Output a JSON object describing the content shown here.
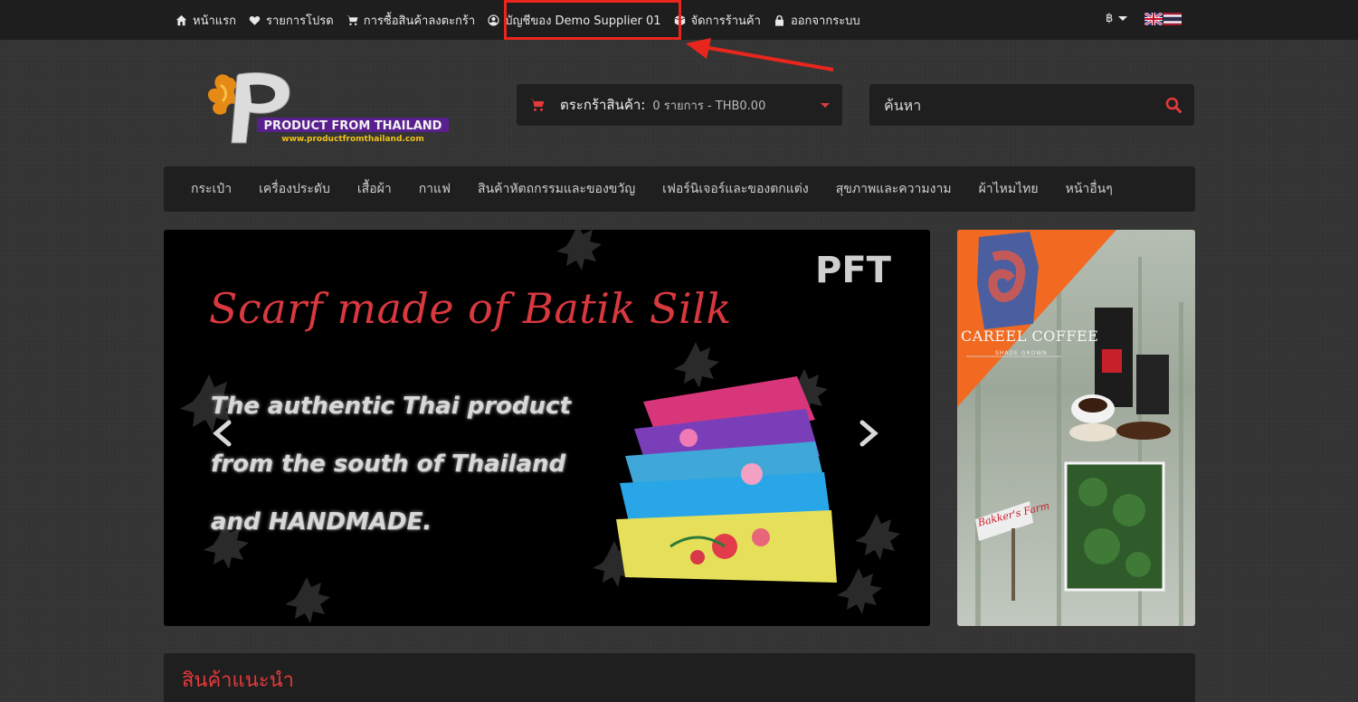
{
  "topbar": {
    "home_label": "หน้าแรก",
    "wishlist_label": "รายการโปรด",
    "cart_label": "การซื้อสินค้าลงตะกร้า",
    "account_label": "บัญชีของ Demo Supplier 01",
    "manage_store_label": "จัดการร้านค้า",
    "logout_label": "ออกจากระบบ",
    "currency_symbol": "฿",
    "languages": [
      "English",
      "Thai"
    ]
  },
  "logo": {
    "brand": "PRODUCT FROM THAILAND",
    "url_text": "www.productfromthailand.com"
  },
  "cart": {
    "title": "ตระกร้าสินค้า:",
    "summary": "0 รายการ - THB0.00"
  },
  "search": {
    "placeholder": "ค้นหา"
  },
  "categories": [
    "กระเป๋า",
    "เครื่องประดับ",
    "เสื้อผ้า",
    "กาแฟ",
    "สินค้าหัตถกรรมและของขวัญ",
    "เฟอร์นิเจอร์และของตกแต่ง",
    "สุขภาพและความงาม",
    "ผ้าไหมไทย",
    "หน้าอื่นๆ"
  ],
  "slider": {
    "title": "Scarf made of Batik Silk",
    "lines": [
      "The authentic Thai product",
      "from the south of Thailand",
      "and HANDMADE."
    ],
    "brand_mark": "PFT"
  },
  "banner": {
    "name": "CAREEL COFFEE",
    "sub": "SHADE GROWN",
    "sign": "Bakker's Farm"
  },
  "recommended": {
    "title": "สินค้าแนะนำ"
  },
  "colors": {
    "accent": "#e5393b",
    "highlight_box": "#e8261d",
    "topbar_bg": "#1e1e1e",
    "panel_bg": "#1f1f1f"
  }
}
